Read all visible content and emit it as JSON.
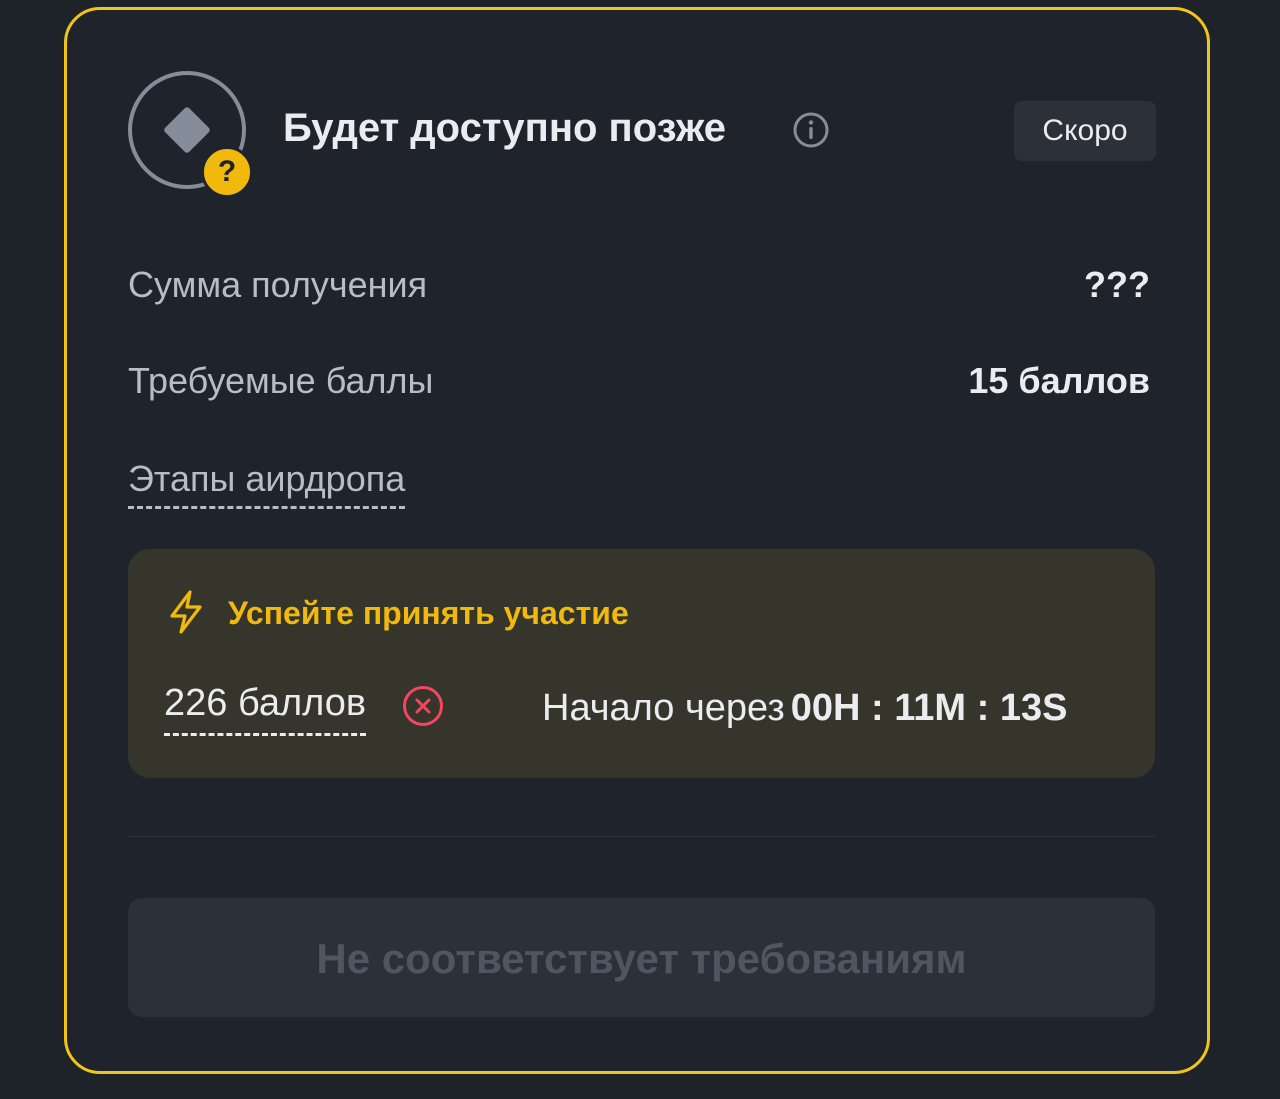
{
  "header": {
    "title": "Будет доступно позже",
    "badge": "Скоро",
    "token_icon": "diamond-icon",
    "question_mark": "?"
  },
  "details": {
    "amount_label": "Сумма получения",
    "amount_value": "???",
    "required_points_label": "Требуемые баллы",
    "required_points_value": "15 баллов",
    "stages_link": "Этапы аирдропа"
  },
  "promo": {
    "title": "Успейте принять участие",
    "points": "226 баллов",
    "countdown_label": "Начало через",
    "countdown_value": "00H : 11M : 13S"
  },
  "action": {
    "button_label": "Не соответствует требованиям"
  },
  "colors": {
    "accent": "#f0b90b",
    "card_border": "#f0c419",
    "background": "#1e2329",
    "error": "#f6465d"
  }
}
